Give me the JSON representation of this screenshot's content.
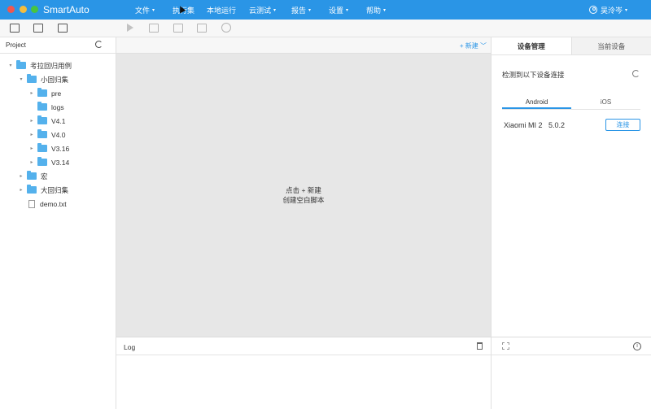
{
  "app": {
    "title": "SmartAuto"
  },
  "menu": [
    {
      "label": "文件",
      "caret": "▾"
    },
    {
      "label": "执行集",
      "caret": ""
    },
    {
      "label": "本地运行",
      "caret": ""
    },
    {
      "label": "云测试",
      "caret": "▾"
    },
    {
      "label": "报告",
      "caret": "▾"
    },
    {
      "label": "设置",
      "caret": "▾"
    },
    {
      "label": "帮助",
      "caret": "▾"
    }
  ],
  "user": {
    "name": "吴泠岑",
    "caret": "▾"
  },
  "project": {
    "label": "Project",
    "tree": [
      {
        "label": "考拉回归用例",
        "type": "folder",
        "arrow": "▾"
      },
      {
        "label": "小回归集",
        "type": "folder",
        "arrow": "▾"
      },
      {
        "label": "pre",
        "type": "folder",
        "arrow": "▸"
      },
      {
        "label": "logs",
        "type": "folder",
        "arrow": ""
      },
      {
        "label": "V4.1",
        "type": "folder",
        "arrow": "▸"
      },
      {
        "label": "V4.0",
        "type": "folder",
        "arrow": "▸"
      },
      {
        "label": "V3.16",
        "type": "folder",
        "arrow": "▸"
      },
      {
        "label": "V3.14",
        "type": "folder",
        "arrow": "▸"
      },
      {
        "label": "宏",
        "type": "folder",
        "arrow": "▸"
      },
      {
        "label": "大回归集",
        "type": "folder",
        "arrow": "▸"
      },
      {
        "label": "demo.txt",
        "type": "file",
        "arrow": ""
      }
    ]
  },
  "editor": {
    "new_label": "+ 新建 ﹀",
    "hint_line1": "点击 + 新建",
    "hint_line2": "创建空白脚本"
  },
  "log": {
    "title": "Log"
  },
  "devices": {
    "tabs": [
      "设备管理",
      "当前设备"
    ],
    "detected_text": "检测到以下设备连接",
    "os_tabs": [
      "Android",
      "iOS"
    ],
    "device": {
      "name": "Xiaomi MI 2",
      "version": "5.0.2",
      "connect_label": "连接"
    }
  },
  "icons": {
    "info": "i"
  }
}
